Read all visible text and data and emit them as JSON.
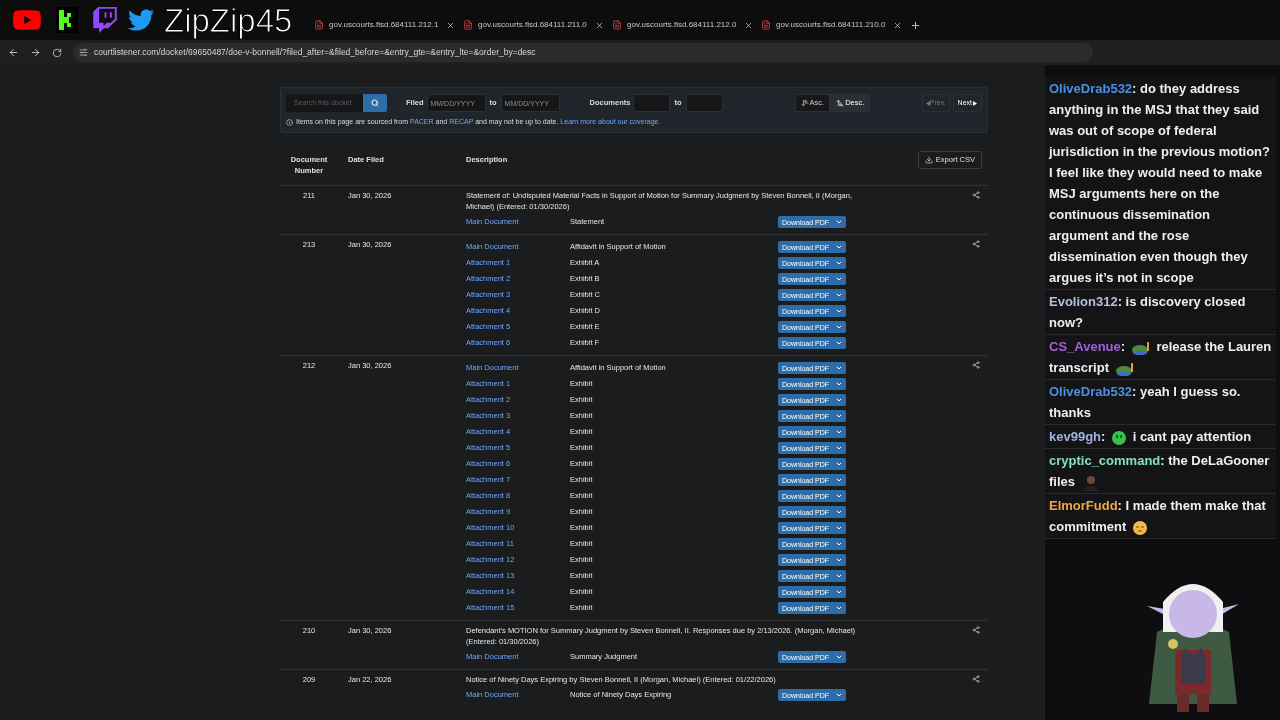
{
  "overlay": {
    "channel_name": "ZipZip45"
  },
  "browser": {
    "tabs": [
      {
        "title": "gov.uscourts.flsd.684111.212.1"
      },
      {
        "title": "gov.uscourts.flsd.684111.211.0"
      },
      {
        "title": "gov.uscourts.flsd.684111.212.0"
      },
      {
        "title": "gov.uscourts.flsd.684111.210.0"
      }
    ],
    "url": "courtlistener.com/docket/69650487/doe-v-bonnell/?filed_after=&filed_before=&entry_gte=&entry_lte=&order_by=desc"
  },
  "filters": {
    "search_placeholder": "Search this docket",
    "filed_label": "Filed",
    "date_from_placeholder": "MM/DD/YYYY",
    "date_to_label": "to",
    "date_to_placeholder": "MM/DD/YYYY",
    "documents_label": "Documents",
    "documents_to_label": "to",
    "sort": [
      {
        "label": "Asc.",
        "selected": false
      },
      {
        "label": "Desc.",
        "selected": true
      }
    ],
    "prev": "Prev.",
    "next": "Next"
  },
  "notice": [
    {
      "kind": "text",
      "text": "Items on this page are sourced from "
    },
    {
      "kind": "link",
      "text": "PACER"
    },
    {
      "kind": "text",
      "text": " and "
    },
    {
      "kind": "link",
      "text": "RECAP"
    },
    {
      "kind": "text",
      "text": " and may not be up to date. "
    },
    {
      "kind": "link",
      "text": "Learn more about our coverage."
    }
  ],
  "table": {
    "columns": [
      "Document Number",
      "Date Filed",
      "Description"
    ],
    "export": "Export CSV",
    "entries": [
      {
        "number": "211",
        "date": "Jan 30, 2026",
        "description": "Statement of: Undisputed Material Facts in Support of Motion for Summary Judgment by Steven Bonnell, II (Morgan, Michael) (Entered: 01/30/2026)",
        "documents": [
          {
            "link": "Main Document",
            "description": "Statement",
            "button": "Download PDF"
          }
        ]
      },
      {
        "number": "213",
        "date": "Jan 30, 2026",
        "documents": [
          {
            "link": "Main Document",
            "description": "Affidavit in Support of Motion",
            "button": "Download PDF"
          },
          {
            "link": "Attachment 1",
            "description": "Exhibit A",
            "button": "Download PDF"
          },
          {
            "link": "Attachment 2",
            "description": "Exhibit B",
            "button": "Download PDF"
          },
          {
            "link": "Attachment 3",
            "description": "Exhibit C",
            "button": "Download PDF"
          },
          {
            "link": "Attachment 4",
            "description": "Exhibit D",
            "button": "Download PDF"
          },
          {
            "link": "Attachment 5",
            "description": "Exhibit E",
            "button": "Download PDF"
          },
          {
            "link": "Attachment 6",
            "description": "Exhibit F",
            "button": "Download PDF"
          }
        ]
      },
      {
        "number": "212",
        "date": "Jan 30, 2026",
        "documents": [
          {
            "link": "Main Document",
            "description": "Affidavit in Support of Motion",
            "button": "Download PDF"
          },
          {
            "link": "Attachment 1",
            "description": "Exhibit",
            "button": "Download PDF"
          },
          {
            "link": "Attachment 2",
            "description": "Exhibit",
            "button": "Download PDF"
          },
          {
            "link": "Attachment 3",
            "description": "Exhibit",
            "button": "Download PDF"
          },
          {
            "link": "Attachment 4",
            "description": "Exhibit",
            "button": "Download PDF"
          },
          {
            "link": "Attachment 5",
            "description": "Exhibit",
            "button": "Download PDF"
          },
          {
            "link": "Attachment 6",
            "description": "Exhibit",
            "button": "Download PDF"
          },
          {
            "link": "Attachment 7",
            "description": "Exhibit",
            "button": "Download PDF"
          },
          {
            "link": "Attachment 8",
            "description": "Exhibit",
            "button": "Download PDF"
          },
          {
            "link": "Attachment 9",
            "description": "Exhibit",
            "button": "Download PDF"
          },
          {
            "link": "Attachment 10",
            "description": "Exhibit",
            "button": "Download PDF"
          },
          {
            "link": "Attachment 11",
            "description": "Exhibit",
            "button": "Download PDF"
          },
          {
            "link": "Attachment 12",
            "description": "Exhibit",
            "button": "Download PDF"
          },
          {
            "link": "Attachment 13",
            "description": "Exhibit",
            "button": "Download PDF"
          },
          {
            "link": "Attachment 14",
            "description": "Exhibit",
            "button": "Download PDF"
          },
          {
            "link": "Attachment 15",
            "description": "Exhibit",
            "button": "Download PDF"
          }
        ]
      },
      {
        "number": "210",
        "date": "Jan 30, 2026",
        "description": "Defendant's MOTION for Summary Judgment by Steven Bonnell, II. Responses due by 2/13/2026. (Morgan, Michael) (Entered: 01/30/2026)",
        "documents": [
          {
            "link": "Main Document",
            "description": "Summary Judgment",
            "button": "Download PDF"
          }
        ]
      },
      {
        "number": "209",
        "date": "Jan 22, 2026",
        "description": "Notice of Ninety Days Expiring by Steven Bonnell, II (Morgan, Michael) (Entered: 01/22/2026)",
        "documents": [
          {
            "link": "Main Document",
            "description": "Notice of Ninety Days Expiring",
            "button": "Download PDF"
          }
        ]
      }
    ]
  },
  "chat": {
    "messages": [
      {
        "user": "OliveDrab532",
        "color": "#4a8fe0",
        "parts": [
          {
            "kind": "text",
            "text": ": do they address anything in the MSJ that they said was out of scope of federal jurisdiction in the previous motion? I feel like they would need to make MSJ arguments here on the continuous dissemination argument and the rose dissemination even though they argues it’s not in scope"
          }
        ]
      },
      {
        "user": "Evolion312",
        "color": "#b3c0e0",
        "parts": [
          {
            "kind": "text",
            "text": ": is discovery closed now?"
          }
        ]
      },
      {
        "user": "CS_Avenue",
        "color": "#a35ee0",
        "parts": [
          {
            "kind": "text",
            "text": ": "
          },
          {
            "kind": "frog_emote"
          },
          {
            "kind": "text",
            "text": " release the Lauren transcript "
          },
          {
            "kind": "frog_emote"
          }
        ]
      },
      {
        "user": "OliveDrab532",
        "color": "#4a8fe0",
        "parts": [
          {
            "kind": "text",
            "text": ": yeah I guess so. thanks"
          }
        ]
      },
      {
        "user": "kev99gh",
        "color": "#9fb3e0",
        "parts": [
          {
            "kind": "text",
            "text": ": "
          },
          {
            "kind": "blob_emote"
          },
          {
            "kind": "text",
            "text": " i cant pay attention"
          }
        ]
      },
      {
        "user": "cryptic_command",
        "color": "#83e0b8",
        "parts": [
          {
            "kind": "text",
            "text": ": the DeLaGooner files "
          },
          {
            "kind": "figure_emote"
          }
        ]
      },
      {
        "user": "ElmorFudd",
        "color": "#f0a63c",
        "parts": [
          {
            "kind": "text",
            "text": ": I made them make that commitment "
          },
          {
            "kind": "face_emote"
          }
        ]
      }
    ]
  }
}
